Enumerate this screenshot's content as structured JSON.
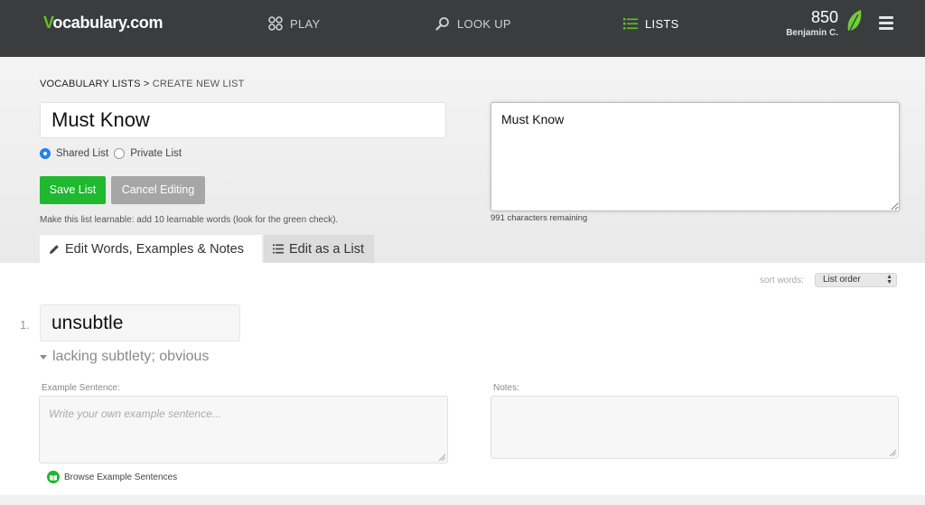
{
  "nav": {
    "logo_v": "V",
    "logo_rest": "ocabulary.com",
    "play": "PLAY",
    "lookup": "LOOK UP",
    "lists": "LISTS",
    "score": "850",
    "user": "Benjamin C."
  },
  "breadcrumb": {
    "parent": "VOCABULARY LISTS",
    "separator": " > ",
    "current": "CREATE NEW LIST"
  },
  "list": {
    "title_value": "Must Know",
    "description_value": "Must Know",
    "chars_remaining": "991 characters remaining",
    "shared_label": "Shared List",
    "private_label": "Private List",
    "visibility_selected": "shared"
  },
  "actions": {
    "save": "Save List",
    "cancel": "Cancel Editing",
    "hint": "Make this list learnable: add 10 learnable words (look for the green check)."
  },
  "tabs": {
    "edit_words": "Edit Words, Examples & Notes",
    "edit_list": "Edit as a List"
  },
  "sort": {
    "label": "sort words:",
    "selected": "List order"
  },
  "words": [
    {
      "number": "1.",
      "word": "unsubtle",
      "definition": "lacking subtlety; obvious",
      "example_label": "Example Sentence:",
      "example_placeholder": "Write your own example sentence...",
      "notes_label": "Notes:",
      "browse": "Browse Example Sentences"
    }
  ],
  "colors": {
    "nav_bg": "#3b3c3e",
    "accent_green": "#1fb82f",
    "radio_blue": "#2484ef"
  },
  "icons": [
    "play-icon",
    "search-icon",
    "list-icon",
    "leaf-icon",
    "menu-icon",
    "pencil-icon",
    "list-lines-icon",
    "book-icon"
  ]
}
